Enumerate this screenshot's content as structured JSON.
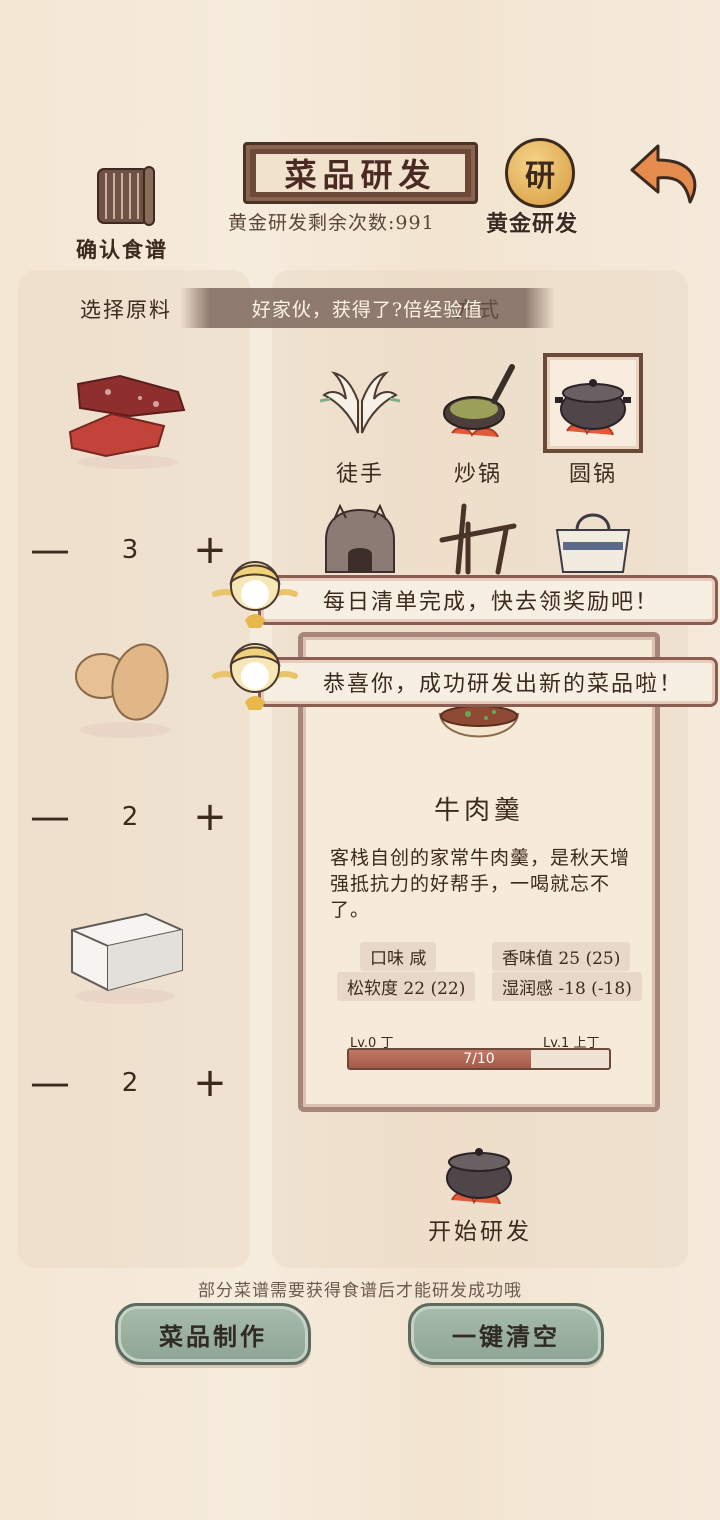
{
  "header": {
    "title": "菜品研发",
    "remaining_text": "黄金研发剩余次数:991",
    "recipe_button_label": "确认食谱",
    "gold_button_icon_text": "研",
    "gold_button_label": "黄金研发"
  },
  "left_panel": {
    "title": "选择原料",
    "ingredients": [
      {
        "icon": "beef-icon",
        "quantity": "3"
      },
      {
        "icon": "egg-icon",
        "quantity": "2"
      },
      {
        "icon": "tofu-icon",
        "quantity": "2"
      }
    ],
    "minus_label": "—",
    "plus_label": "+"
  },
  "toast": "好家伙，获得了?倍经验值",
  "right_panel": {
    "title": "方式",
    "tools": [
      {
        "label": "徒手",
        "icon": "hands-icon",
        "selected": false
      },
      {
        "label": "炒锅",
        "icon": "wok-icon",
        "selected": false
      },
      {
        "label": "圆锅",
        "icon": "round-pot-icon",
        "selected": true
      },
      {
        "label": "",
        "icon": "oven-icon",
        "selected": false
      },
      {
        "label": "",
        "icon": "grill-rack-icon",
        "selected": false
      },
      {
        "label": "",
        "icon": "steamer-basket-icon",
        "selected": false
      }
    ]
  },
  "result": {
    "dish_name": "牛肉羹",
    "description": "客栈自创的家常牛肉羹，是秋天增强抵抗力的好帮手，一喝就忘不了。",
    "stats": {
      "taste": "口味 咸",
      "aroma": "香味值 25 (25)",
      "softness": "松软度 22 (22)",
      "moisture": "湿润感 -18 (-18)"
    },
    "level_left": "Lv.0 丁",
    "level_right": "Lv.1 上丁",
    "progress_text": "7/10",
    "progress": 0.7
  },
  "start_button_label": "开始研发",
  "notifications": [
    "每日清单完成，快去领奖励吧！",
    "恭喜你，成功研发出新的菜品啦！"
  ],
  "hint": "部分菜谱需要获得食谱后才能研发成功哦",
  "buttons": {
    "make_dish": "菜品制作",
    "clear_all": "一键清空"
  },
  "colors": {
    "background": "#f4e8d8",
    "frame_brown": "#6b4a3a",
    "stone_button": "#9fb3a2",
    "progress_fill": "#b4604e"
  }
}
